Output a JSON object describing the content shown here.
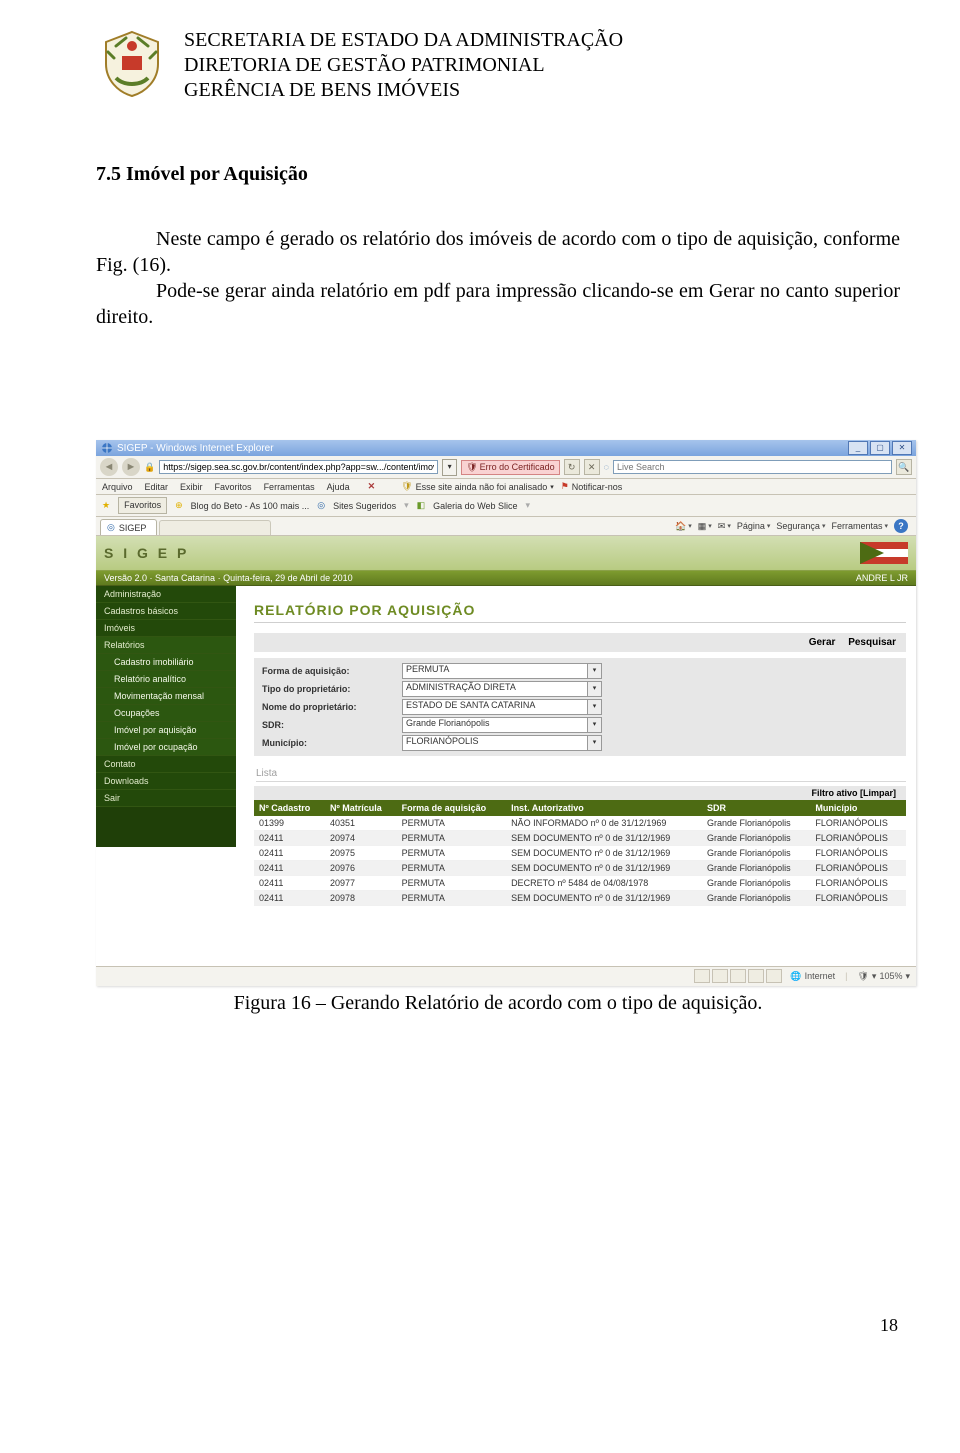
{
  "letterhead": {
    "line1": "SECRETARIA DE ESTADO DA ADMINISTRAÇÃO",
    "line2": "DIRETORIA DE GESTÃO PATRIMONIAL",
    "line3": "GERÊNCIA DE BENS IMÓVEIS"
  },
  "section_title": "7.5 Imóvel por Aquisição",
  "body": {
    "p1": "Neste campo é gerado os relatório dos imóveis de acordo com o tipo de aquisição, conforme Fig. (16).",
    "p2": "Pode-se gerar ainda relatório em pdf para impressão clicando-se em Gerar no canto superior direito."
  },
  "ie": {
    "window_title": "SIGEP - Windows Internet Explorer",
    "url": "https://sigep.sea.sc.gov.br/content/index.php?app=sw.../content/imovel_pesquisar_listar.php",
    "cert_error": "Erro do Certificado",
    "search_placeholder": "Live Search",
    "menu": [
      "Arquivo",
      "Editar",
      "Exibir",
      "Favoritos",
      "Ferramentas",
      "Ajuda"
    ],
    "security_warn": "Esse site ainda não foi analisado",
    "security_notify": "Notificar-nos",
    "fav_button": "Favoritos",
    "fav_links": [
      "Blog do Beto - As 100 mais ...",
      "Sites Sugeridos",
      "Galeria do Web Slice"
    ],
    "tab_label": "SIGEP",
    "tools": {
      "page": "Página",
      "security": "Segurança",
      "tools": "Ferramentas"
    },
    "status_internet": "Internet",
    "zoom": "105%"
  },
  "app": {
    "logo": "S I G E P",
    "version_line": "Versão 2.0 · Santa Catarina · Quinta-feira, 29 de Abril de 2010",
    "user": "ANDRE L JR"
  },
  "sidebar": {
    "items": [
      "Administração",
      "Cadastros básicos",
      "Imóveis",
      "Relatórios"
    ],
    "subitems": [
      "Cadastro imobiliário",
      "Relatório analítico",
      "Movimentação mensal",
      "Ocupações",
      "Imóvel por aquisição",
      "Imóvel por ocupação"
    ],
    "bottom": [
      "Contato",
      "Downloads",
      "Sair"
    ]
  },
  "main": {
    "title": "RELATÓRIO POR AQUISIÇÃO",
    "actions": {
      "gerar": "Gerar",
      "pesquisar": "Pesquisar"
    },
    "form": {
      "forma_label": "Forma de aquisição:",
      "forma_value": "PERMUTA",
      "tipo_label": "Tipo do proprietário:",
      "tipo_value": "ADMINISTRAÇÃO DIRETA",
      "nome_label": "Nome do proprietário:",
      "nome_value": "ESTADO DE SANTA CATARINA",
      "sdr_label": "SDR:",
      "sdr_value": "Grande Florianópolis",
      "mun_label": "Município:",
      "mun_value": "FLORIANÓPOLIS"
    },
    "lista_label": "Lista",
    "filter_label": "Filtro ativo [Limpar]",
    "columns": [
      "Nº Cadastro",
      "Nº Matrícula",
      "Forma de aquisição",
      "Inst. Autorizativo",
      "SDR",
      "Município"
    ],
    "rows": [
      {
        "c": "01399",
        "m": "40351",
        "f": "PERMUTA",
        "i": "NÃO INFORMADO nº 0 de 31/12/1969",
        "s": "Grande Florianópolis",
        "u": "FLORIANÓPOLIS"
      },
      {
        "c": "02411",
        "m": "20974",
        "f": "PERMUTA",
        "i": "SEM DOCUMENTO nº 0 de 31/12/1969",
        "s": "Grande Florianópolis",
        "u": "FLORIANÓPOLIS"
      },
      {
        "c": "02411",
        "m": "20975",
        "f": "PERMUTA",
        "i": "SEM DOCUMENTO nº 0 de 31/12/1969",
        "s": "Grande Florianópolis",
        "u": "FLORIANÓPOLIS"
      },
      {
        "c": "02411",
        "m": "20976",
        "f": "PERMUTA",
        "i": "SEM DOCUMENTO nº 0 de 31/12/1969",
        "s": "Grande Florianópolis",
        "u": "FLORIANÓPOLIS"
      },
      {
        "c": "02411",
        "m": "20977",
        "f": "PERMUTA",
        "i": "DECRETO nº 5484 de 04/08/1978",
        "s": "Grande Florianópolis",
        "u": "FLORIANÓPOLIS"
      },
      {
        "c": "02411",
        "m": "20978",
        "f": "PERMUTA",
        "i": "SEM DOCUMENTO nº 0 de 31/12/1969",
        "s": "Grande Florianópolis",
        "u": "FLORIANÓPOLIS"
      }
    ]
  },
  "caption": "Figura 16 – Gerando Relatório de acordo com o tipo de aquisição.",
  "page_number": "18"
}
